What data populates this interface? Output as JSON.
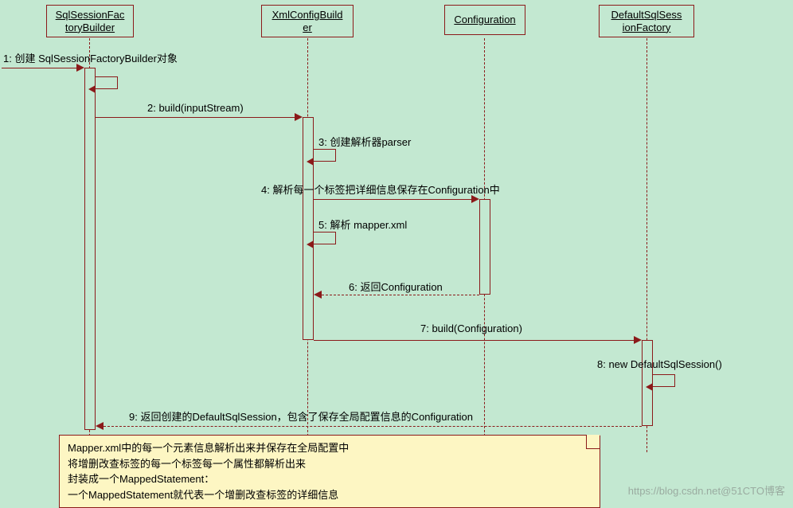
{
  "participants": {
    "p1": "SqlSessionFactoryBuilder",
    "p1a": "SqlSessionFac",
    "p1b": "toryBuilder",
    "p2": "XmlConfigBuilder",
    "p2a": "XmlConfigBuild",
    "p2b": "er",
    "p3": "Configuration",
    "p4": "DefaultSqlSessionFactory",
    "p4a": "DefaultSqlSess",
    "p4b": "ionFactory"
  },
  "messages": {
    "m1": "1: 创建 SqlSessionFactoryBuilder对象",
    "m2": "2: build(inputStream)",
    "m3": "3: 创建解析器parser",
    "m4": "4: 解析每一个标签把详细信息保存在Configuration中",
    "m5": "5: 解析 mapper.xml",
    "m6": "6: 返回Configuration",
    "m7": "7: build(Configuration)",
    "m8": "8: new DefaultSqlSession()",
    "m9": "9: 返回创建的DefaultSqlSession，包含了保存全局配置信息的Configuration"
  },
  "note_lines": {
    "l1": "Mapper.xml中的每一个元素信息解析出来并保存在全局配置中",
    "l2": "将增删改查标签的每一个标签每一个属性都解析出来",
    "l3": "封装成一个MappedStatement：",
    "l4": "一个MappedStatement就代表一个增删改查标签的详细信息"
  },
  "watermark": "https://blog.csdn.net@51CTO博客",
  "chart_data": {
    "type": "sequence-diagram",
    "participants": [
      "SqlSessionFactoryBuilder",
      "XmlConfigBuilder",
      "Configuration",
      "DefaultSqlSessionFactory"
    ],
    "messages": [
      {
        "n": 1,
        "from": "(external)",
        "to": "SqlSessionFactoryBuilder",
        "label": "创建 SqlSessionFactoryBuilder对象",
        "kind": "sync"
      },
      {
        "n": 2,
        "from": "SqlSessionFactoryBuilder",
        "to": "XmlConfigBuilder",
        "label": "build(inputStream)",
        "kind": "sync"
      },
      {
        "n": 3,
        "from": "XmlConfigBuilder",
        "to": "XmlConfigBuilder",
        "label": "创建解析器parser",
        "kind": "self"
      },
      {
        "n": 4,
        "from": "XmlConfigBuilder",
        "to": "Configuration",
        "label": "解析每一个标签把详细信息保存在Configuration中",
        "kind": "sync"
      },
      {
        "n": 5,
        "from": "XmlConfigBuilder",
        "to": "XmlConfigBuilder",
        "label": "解析 mapper.xml",
        "kind": "self"
      },
      {
        "n": 6,
        "from": "Configuration",
        "to": "XmlConfigBuilder",
        "label": "返回Configuration",
        "kind": "return"
      },
      {
        "n": 7,
        "from": "XmlConfigBuilder",
        "to": "DefaultSqlSessionFactory",
        "label": "build(Configuration)",
        "kind": "sync"
      },
      {
        "n": 8,
        "from": "DefaultSqlSessionFactory",
        "to": "DefaultSqlSessionFactory",
        "label": "new DefaultSqlSession()",
        "kind": "self"
      },
      {
        "n": 9,
        "from": "DefaultSqlSessionFactory",
        "to": "SqlSessionFactoryBuilder",
        "label": "返回创建的DefaultSqlSession，包含了保存全局配置信息的Configuration",
        "kind": "return"
      }
    ],
    "note": "Mapper.xml中的每一个元素信息解析出来并保存在全局配置中\n将增删改查标签的每一个标签每一个属性都解析出来\n封装成一个MappedStatement：\n一个MappedStatement就代表一个增删改查标签的详细信息"
  }
}
